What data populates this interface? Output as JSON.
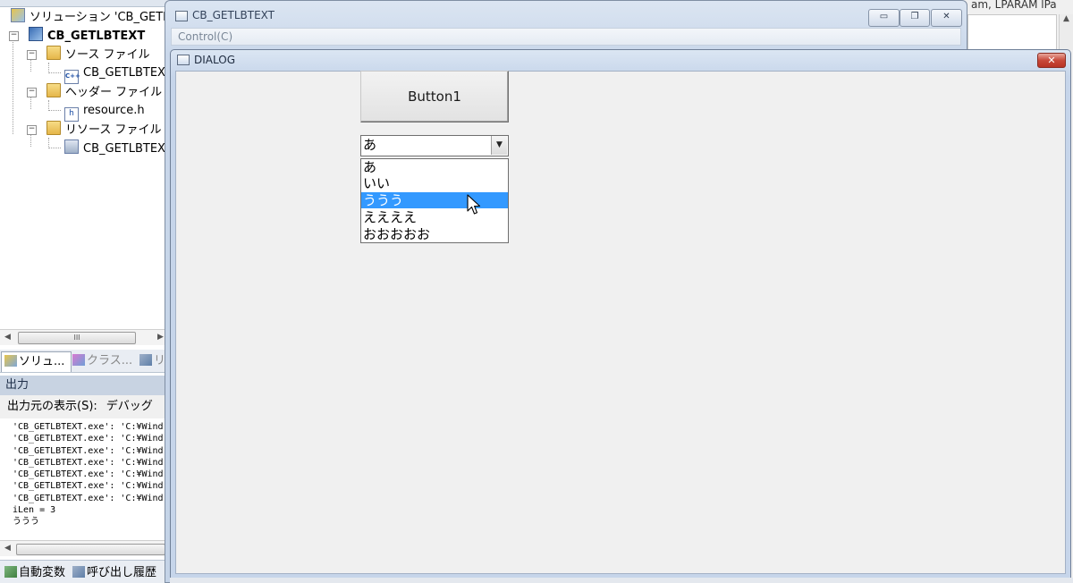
{
  "ide": {
    "solution_label": "ソリューション 'CB_GETL",
    "project_label": "CB_GETLBTEXT",
    "folders": [
      {
        "label": "ソース ファイル",
        "file": "CB_GETLBTEX"
      },
      {
        "label": "ヘッダー ファイル",
        "file": "resource.h"
      },
      {
        "label": "リソース ファイル",
        "file": "CB_GETLBTEX"
      }
    ],
    "scroll_thumb": "III",
    "tabs": [
      "ソリュ...",
      "クラス...",
      "リ"
    ],
    "output": {
      "header": "出力",
      "source_label": "出力元の表示(S):",
      "source_value": "デバッグ",
      "lines": [
        "'CB_GETLBTEXT.exe': 'C:¥Wind",
        "'CB_GETLBTEXT.exe': 'C:¥Wind",
        "'CB_GETLBTEXT.exe': 'C:¥Wind",
        "'CB_GETLBTEXT.exe': 'C:¥Wind",
        "'CB_GETLBTEXT.exe': 'C:¥Wind",
        "'CB_GETLBTEXT.exe': 'C:¥Wind",
        "'CB_GETLBTEXT.exe': 'C:¥Wind",
        "iLen = 3",
        "ううう"
      ]
    },
    "bottom_tabs": [
      "自動変数",
      "呼び出し履歴"
    ]
  },
  "right_strip": {
    "text": "am, LPARAM lPa"
  },
  "main_window": {
    "title": "CB_GETLBTEXT",
    "menu": "Control(C)",
    "caption_buttons": {
      "minimize": "▭",
      "restore": "❐",
      "close": "✕"
    }
  },
  "dialog": {
    "title": "DIALOG",
    "close": "✕",
    "button1": "Button1",
    "combo": {
      "value": "あ",
      "arrow": "▼",
      "items": [
        "あ",
        "いい",
        "ううう",
        "ええええ",
        "おおおおお"
      ],
      "selected_index": 2
    }
  },
  "colors": {
    "selection": "#3399ff",
    "close_button": "#c8493a",
    "window_frame": "#c6d5ea"
  }
}
